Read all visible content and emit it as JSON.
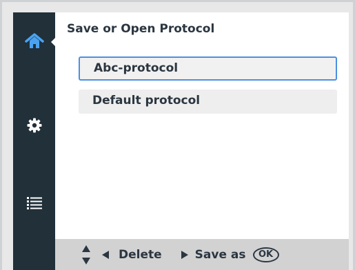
{
  "panel": {
    "title": "Save or Open Protocol",
    "items": [
      {
        "label": "Abc-protocol",
        "selected": true
      },
      {
        "label": "Default protocol",
        "selected": false
      }
    ]
  },
  "sidebar": {
    "items": [
      {
        "icon": "home-icon",
        "active": true
      },
      {
        "icon": "gear-icon",
        "active": false
      },
      {
        "icon": "list-icon",
        "active": false
      }
    ]
  },
  "footer": {
    "nav_icon": "up-down-arrows-icon",
    "left_label": "Delete",
    "right_label": "Save as",
    "ok_label": "OK"
  },
  "colors": {
    "sidebar": "#213039",
    "accent": "#4a90e2",
    "text": "#2b3640",
    "footer": "#d2d2d2"
  }
}
